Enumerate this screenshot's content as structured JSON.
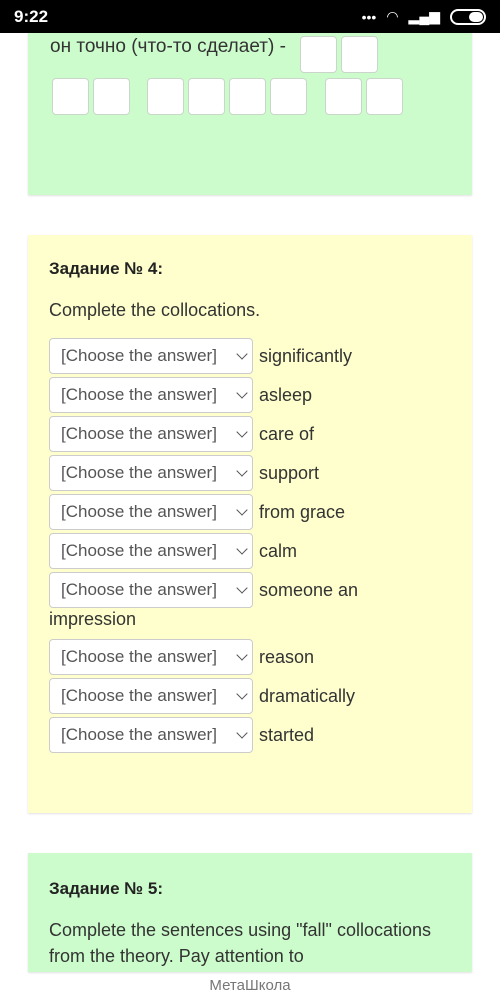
{
  "status_bar": {
    "time": "9:22",
    "icons": [
      "dots-icon",
      "wifi-icon",
      "signal-icon",
      "battery-icon"
    ]
  },
  "prev_task": {
    "text_fragment": "он точно (что-то сделает) -"
  },
  "task4": {
    "title": "Задание № 4:",
    "instruction": "Complete the collocations.",
    "placeholder": "[Choose the answer]",
    "items": [
      {
        "word": "significantly"
      },
      {
        "word": "asleep"
      },
      {
        "word": "care of"
      },
      {
        "word": "support"
      },
      {
        "word": "from grace"
      },
      {
        "word": "calm"
      },
      {
        "word": "someone an",
        "wrap": "impression"
      },
      {
        "word": "reason"
      },
      {
        "word": "dramatically"
      },
      {
        "word": "started"
      }
    ]
  },
  "task5": {
    "title": "Задание № 5:",
    "instruction": "Complete the sentences using  \"fall\" collocations from the theory. Pay attention to"
  },
  "footer": {
    "brand": "МетаШкола"
  },
  "colors": {
    "green_card": "#ccfccb",
    "yellow_card": "#feffcc"
  }
}
